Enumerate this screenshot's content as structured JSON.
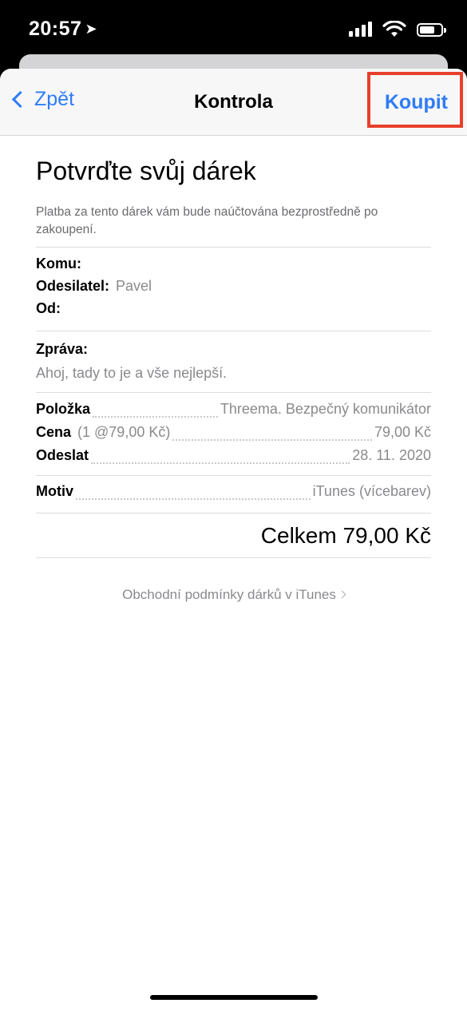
{
  "status_bar": {
    "time": "20:57",
    "location_icon": "location-arrow-icon",
    "signal_icon": "cellular-signal-icon",
    "wifi_icon": "wifi-icon",
    "battery_icon": "battery-icon",
    "battery_level": 0.7
  },
  "navbar": {
    "back_label": "Zpět",
    "title": "Kontrola",
    "buy_label": "Koupit",
    "accent_color": "#2f7cf6",
    "highlight_color": "#e7402c"
  },
  "content": {
    "title": "Potvrďte svůj dárek",
    "notice": "Platba za tento dárek vám bude naúčtována bezprostředně po zakoupení.",
    "recipient": {
      "to_label": "Komu:",
      "to_value": "",
      "sender_label": "Odesilatel:",
      "sender_value": "Pavel",
      "from_label": "Od:",
      "from_value": ""
    },
    "message": {
      "label": "Zpráva:",
      "text": "Ahoj, tady to je a vše nejlepší."
    },
    "details": {
      "item_label": "Položka",
      "item_value": "Threema. Bezpečný komunikátor",
      "price_label": "Cena",
      "price_sub": "(1 @79,00 Kč)",
      "price_value": "79,00 Kč",
      "send_label": "Odeslat",
      "send_value": "28. 11. 2020"
    },
    "theme": {
      "label": "Motiv",
      "value": "iTunes (vícebarev)"
    },
    "total": "Celkem 79,00 Kč",
    "terms_link": "Obchodní podmínky dárků v iTunes"
  }
}
